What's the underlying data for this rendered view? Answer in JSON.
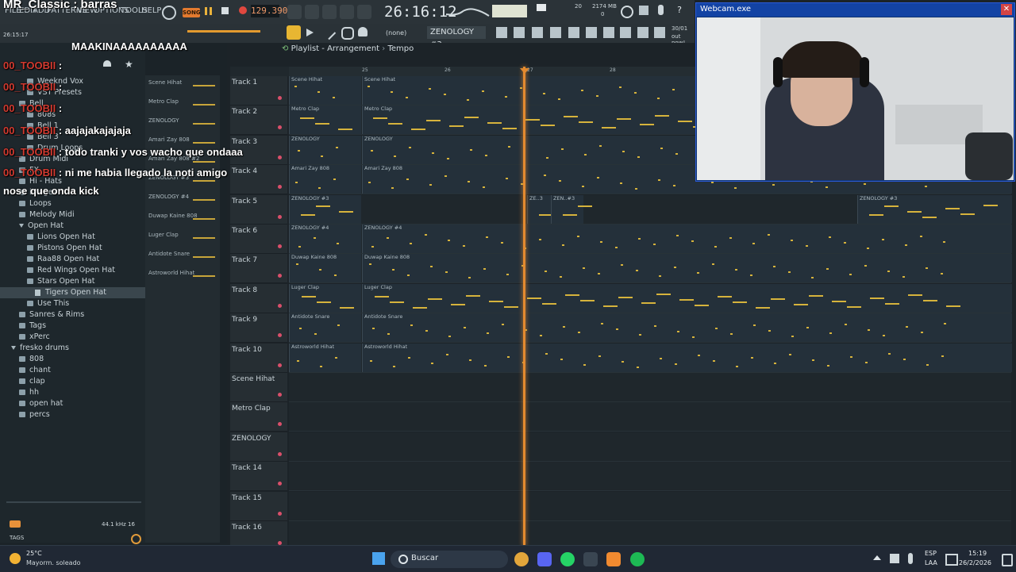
{
  "fl": {
    "title": "MR_Classic",
    "menus": [
      "FILE",
      "EDIT",
      "ADD",
      "PATTERNS",
      "VIEW",
      "OPTIONS",
      "TOOLS",
      "HELP"
    ],
    "song_mode": "SONG",
    "tempo": "129.390",
    "time": "26:16:12",
    "time_sub": "26:15:17",
    "cpu_mem": "2174 MB",
    "cpu_a": "20",
    "cpu_b": "0",
    "hint_date": "30/01",
    "hint_text": "out now!",
    "pattern": "ZENOLOGY #3",
    "snap": "(none)",
    "playlist_title": "Playlist - Arrangement",
    "playlist_tempo_crumb": "Tempo",
    "sample_rate": "44.1 kHz 16",
    "tags": "TAGS",
    "ruler": [
      "25",
      "26",
      "27",
      "28"
    ]
  },
  "browser": {
    "items": [
      {
        "label": "Weeknd Vox",
        "type": "folder",
        "indent": 3
      },
      {
        "label": "VST Presets",
        "type": "folder",
        "indent": 3
      },
      {
        "label": "Bell",
        "type": "folder",
        "indent": 2
      },
      {
        "label": "808s",
        "type": "folder",
        "indent": 3
      },
      {
        "label": "Bell 1",
        "type": "folder",
        "indent": 3
      },
      {
        "label": "Bell 3",
        "type": "folder",
        "indent": 3
      },
      {
        "label": "Drum Loops",
        "type": "folder",
        "indent": 3
      },
      {
        "label": "Drum Midi",
        "type": "folder",
        "indent": 2
      },
      {
        "label": "FX",
        "type": "folder",
        "indent": 2
      },
      {
        "label": "Hi - Hats",
        "type": "folder",
        "indent": 2
      },
      {
        "label": "images",
        "type": "folder",
        "indent": 2
      },
      {
        "label": "Loops",
        "type": "folder",
        "indent": 2
      },
      {
        "label": "Melody Midi",
        "type": "folder",
        "indent": 2
      },
      {
        "label": "Open Hat",
        "type": "open",
        "indent": 2
      },
      {
        "label": "Lions Open Hat",
        "type": "folder",
        "indent": 3
      },
      {
        "label": "Pistons Open Hat",
        "type": "folder",
        "indent": 3
      },
      {
        "label": "Raa88 Open Hat",
        "type": "folder",
        "indent": 3
      },
      {
        "label": "Red Wings Open Hat",
        "type": "folder",
        "indent": 3
      },
      {
        "label": "Stars Open Hat",
        "type": "folder",
        "indent": 3
      },
      {
        "label": "Tigers Open Hat",
        "type": "file",
        "indent": 4,
        "selected": true
      },
      {
        "label": "Use This",
        "type": "folder",
        "indent": 3
      },
      {
        "label": "Sanres & Rims",
        "type": "folder",
        "indent": 2
      },
      {
        "label": "Tags",
        "type": "folder",
        "indent": 2
      },
      {
        "label": "xPerc",
        "type": "folder",
        "indent": 2
      },
      {
        "label": "fresko drums",
        "type": "open",
        "indent": 1
      },
      {
        "label": "808",
        "type": "folder",
        "indent": 2
      },
      {
        "label": "chant",
        "type": "folder",
        "indent": 2
      },
      {
        "label": "clap",
        "type": "folder",
        "indent": 2
      },
      {
        "label": "hh",
        "type": "folder",
        "indent": 2
      },
      {
        "label": "open hat",
        "type": "folder",
        "indent": 2
      },
      {
        "label": "percs",
        "type": "folder",
        "indent": 2
      }
    ]
  },
  "channels": [
    "Scene Hihat",
    "Metro Clap",
    "ZENOLOGY",
    "Amari Zay 808",
    "Amari Zay 808 #2",
    "ZENOLOGY #3",
    "ZENOLOGY #4",
    "Duwap Kaine 808",
    "Luger Clap",
    "Antidote Snare",
    "Astroworld Hihat"
  ],
  "tracks": [
    {
      "name": "Track 1",
      "clips": [
        "Scene Hihat",
        "Scene Hihat"
      ]
    },
    {
      "name": "Track 2",
      "clips": [
        "Metro Clap",
        "Metro Clap"
      ]
    },
    {
      "name": "Track 3",
      "clips": [
        "ZENOLOGY",
        "ZENOLOGY"
      ]
    },
    {
      "name": "Track 4",
      "clips": [
        "Amari Zay 808",
        "Amari Zay 808"
      ]
    },
    {
      "name": "Track 5",
      "clips": [
        "ZENOLOGY #3",
        "ZE..3",
        "ZEN..#3",
        "ZENOLOGY #3"
      ]
    },
    {
      "name": "Track 6",
      "clips": [
        "ZENOLOGY #4",
        "ZENOLOGY #4"
      ]
    },
    {
      "name": "Track 7",
      "clips": [
        "Duwap Kaine 808",
        "Duwap Kaine 808"
      ]
    },
    {
      "name": "Track 8",
      "clips": [
        "Luger Clap",
        "Luger Clap"
      ]
    },
    {
      "name": "Track 9",
      "clips": [
        "Antidote Snare",
        "Antidote Snare"
      ]
    },
    {
      "name": "Track 10",
      "clips": [
        "Astroworld Hihat",
        "Astroworld Hihat"
      ]
    },
    {
      "name": "Scene Hihat",
      "clips": []
    },
    {
      "name": "Metro Clap",
      "clips": []
    },
    {
      "name": "ZENOLOGY",
      "clips": []
    },
    {
      "name": "Track 14",
      "clips": []
    },
    {
      "name": "Track 15",
      "clips": []
    },
    {
      "name": "Track 16",
      "clips": []
    }
  ],
  "chat": [
    {
      "user": "MR_Classic",
      "text": " : barras",
      "color": "#ffffff"
    },
    {
      "user": "",
      "text": "MAAKINAAAAAAAAAA",
      "color": "#ffffff"
    },
    {
      "user": "00_TOOBII",
      "text": " : ",
      "color": "#d23a30"
    },
    {
      "user": "00_TOOBII",
      "text": " : ",
      "color": "#d23a30"
    },
    {
      "user": "00_TOOBII",
      "text": " : ",
      "color": "#d23a30"
    },
    {
      "user": "00_TOOBII",
      "text": " : aajajakajajaja",
      "color": "#d23a30"
    },
    {
      "user": "00_TOOBII",
      "text": " : todo tranki y vos wacho que ondaaa",
      "color": "#d23a30"
    },
    {
      "user": "00_TOOBII",
      "text": " : ni me habia llegado la noti amigo",
      "color": "#d23a30"
    },
    {
      "user": "",
      "text": "nose que onda kick",
      "color": "#ffffff"
    }
  ],
  "webcam": {
    "title": "Webcam.exe",
    "close": "✕"
  },
  "taskbar": {
    "weather_temp": "25°C",
    "weather_text": "Mayorm. soleado",
    "search": "Buscar",
    "lang_top": "ESP",
    "lang_bottom": "LAA",
    "clock": "15:19",
    "date": "26/2/2026"
  }
}
